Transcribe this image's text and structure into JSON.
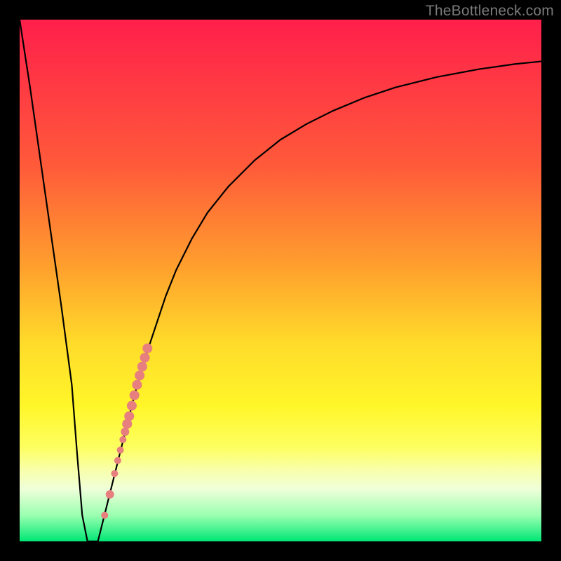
{
  "watermark": "TheBottleneck.com",
  "axis": {
    "xmin": 0,
    "xmax": 100,
    "ymin": 0,
    "ymax": 100
  },
  "gradient": {
    "stops": [
      {
        "offset": 0,
        "color": "#ff1f4b"
      },
      {
        "offset": 28,
        "color": "#ff5a3a"
      },
      {
        "offset": 48,
        "color": "#ffa22d"
      },
      {
        "offset": 62,
        "color": "#ffdb2a"
      },
      {
        "offset": 74,
        "color": "#fff629"
      },
      {
        "offset": 82,
        "color": "#fdff60"
      },
      {
        "offset": 86,
        "color": "#f9ffa6"
      },
      {
        "offset": 90,
        "color": "#efffda"
      },
      {
        "offset": 95,
        "color": "#9affb0"
      },
      {
        "offset": 100,
        "color": "#00e775"
      }
    ]
  },
  "chart_data": {
    "type": "line",
    "title": "",
    "xlabel": "",
    "ylabel": "",
    "xlim": [
      0,
      100
    ],
    "ylim": [
      0,
      100
    ],
    "series": [
      {
        "name": "bottleneck-curve",
        "x": [
          0,
          2,
          4,
          6,
          8,
          10,
          11,
          12,
          13,
          14,
          15,
          16,
          18,
          20,
          22,
          24,
          26,
          28,
          30,
          33,
          36,
          40,
          45,
          50,
          55,
          60,
          66,
          72,
          80,
          88,
          95,
          100
        ],
        "y": [
          100,
          87,
          73,
          59,
          45,
          30,
          17,
          5,
          0,
          0,
          0,
          4,
          12,
          20,
          28,
          35,
          41,
          47,
          52,
          58,
          63,
          68,
          73,
          77,
          80,
          82.5,
          85,
          87,
          89,
          90.5,
          91.5,
          92
        ]
      }
    ],
    "markers": {
      "name": "data-points",
      "color": "#e77f7f",
      "points": [
        {
          "x": 16.3,
          "y": 5,
          "r": 5
        },
        {
          "x": 17.3,
          "y": 9,
          "r": 6
        },
        {
          "x": 18.2,
          "y": 13,
          "r": 5
        },
        {
          "x": 18.8,
          "y": 15.5,
          "r": 5
        },
        {
          "x": 19.3,
          "y": 17.5,
          "r": 5
        },
        {
          "x": 19.8,
          "y": 19.5,
          "r": 5
        },
        {
          "x": 20.2,
          "y": 21,
          "r": 6
        },
        {
          "x": 20.6,
          "y": 22.5,
          "r": 7
        },
        {
          "x": 21.0,
          "y": 24,
          "r": 7
        },
        {
          "x": 21.5,
          "y": 26,
          "r": 7
        },
        {
          "x": 22.0,
          "y": 28,
          "r": 7
        },
        {
          "x": 22.5,
          "y": 30,
          "r": 7
        },
        {
          "x": 23.0,
          "y": 31.8,
          "r": 7
        },
        {
          "x": 23.5,
          "y": 33.5,
          "r": 7
        },
        {
          "x": 24.0,
          "y": 35.2,
          "r": 7
        },
        {
          "x": 24.5,
          "y": 37,
          "r": 7
        }
      ]
    }
  }
}
